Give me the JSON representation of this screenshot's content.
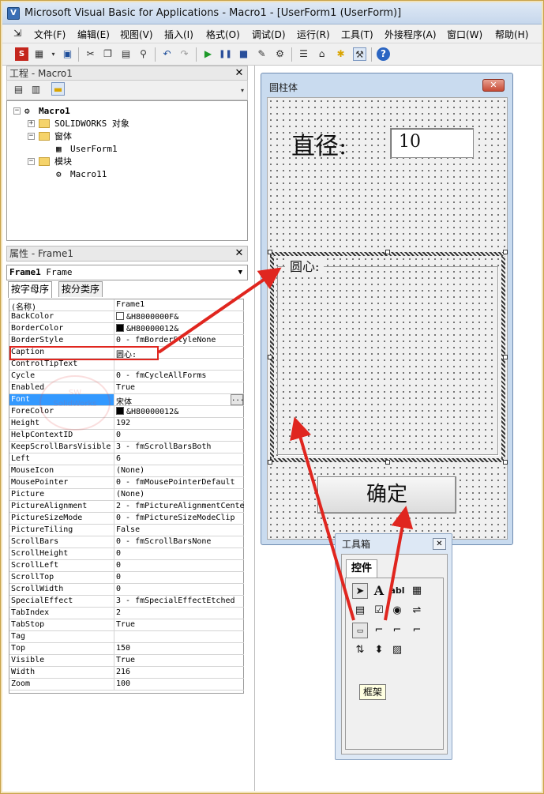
{
  "window": {
    "title": "Microsoft Visual Basic for Applications - Macro1 - [UserForm1 (UserForm)]"
  },
  "menu": [
    "文件(F)",
    "编辑(E)",
    "视图(V)",
    "插入(I)",
    "格式(O)",
    "调试(D)",
    "运行(R)",
    "工具(T)",
    "外接程序(A)",
    "窗口(W)",
    "帮助(H)"
  ],
  "project": {
    "header": "工程 - Macro1",
    "root": "Macro1",
    "items": [
      "SOLIDWORKS 对象",
      "窗体",
      "UserForm1",
      "模块",
      "Macro11"
    ]
  },
  "properties": {
    "header": "属性 - Frame1",
    "object_name": "Frame1",
    "object_type": "Frame",
    "tabs": [
      "按字母序",
      "按分类序"
    ],
    "rows": [
      {
        "name": "(名称)",
        "value": "Frame1"
      },
      {
        "name": "BackColor",
        "value": "&H8000000F&",
        "swatch": "#ffffff"
      },
      {
        "name": "BorderColor",
        "value": "&H80000012&",
        "swatch": "#000000"
      },
      {
        "name": "BorderStyle",
        "value": "0 - fmBorderStyleNone"
      },
      {
        "name": "Caption",
        "value": "圆心:"
      },
      {
        "name": "ControlTipText",
        "value": ""
      },
      {
        "name": "Cycle",
        "value": "0 - fmCycleAllForms"
      },
      {
        "name": "Enabled",
        "value": "True"
      },
      {
        "name": "Font",
        "value": "宋体",
        "selected": true
      },
      {
        "name": "ForeColor",
        "value": "&H80000012&",
        "swatch": "#000000"
      },
      {
        "name": "Height",
        "value": "192"
      },
      {
        "name": "HelpContextID",
        "value": "0"
      },
      {
        "name": "KeepScrollBarsVisible",
        "value": "3 - fmScrollBarsBoth"
      },
      {
        "name": "Left",
        "value": "6"
      },
      {
        "name": "MouseIcon",
        "value": "(None)"
      },
      {
        "name": "MousePointer",
        "value": "0 - fmMousePointerDefault"
      },
      {
        "name": "Picture",
        "value": "(None)"
      },
      {
        "name": "PictureAlignment",
        "value": "2 - fmPictureAlignmentCente"
      },
      {
        "name": "PictureSizeMode",
        "value": "0 - fmPictureSizeModeClip"
      },
      {
        "name": "PictureTiling",
        "value": "False"
      },
      {
        "name": "ScrollBars",
        "value": "0 - fmScrollBarsNone"
      },
      {
        "name": "ScrollHeight",
        "value": "0"
      },
      {
        "name": "ScrollLeft",
        "value": "0"
      },
      {
        "name": "ScrollTop",
        "value": "0"
      },
      {
        "name": "ScrollWidth",
        "value": "0"
      },
      {
        "name": "SpecialEffect",
        "value": "3 - fmSpecialEffectEtched"
      },
      {
        "name": "TabIndex",
        "value": "2"
      },
      {
        "name": "TabStop",
        "value": "True"
      },
      {
        "name": "Tag",
        "value": ""
      },
      {
        "name": "Top",
        "value": "150"
      },
      {
        "name": "Visible",
        "value": "True"
      },
      {
        "name": "Width",
        "value": "216"
      },
      {
        "name": "Zoom",
        "value": "100"
      }
    ]
  },
  "userform": {
    "title": "圆柱体",
    "diameter_label": "直径:",
    "diameter_value": "10",
    "frame_caption": "圆心:",
    "ok_button": "确定"
  },
  "toolbox": {
    "title": "工具箱",
    "tab": "控件",
    "tooltip": "框架"
  },
  "colors": {
    "highlight": "#3399ff",
    "annotation": "#e0261f"
  }
}
